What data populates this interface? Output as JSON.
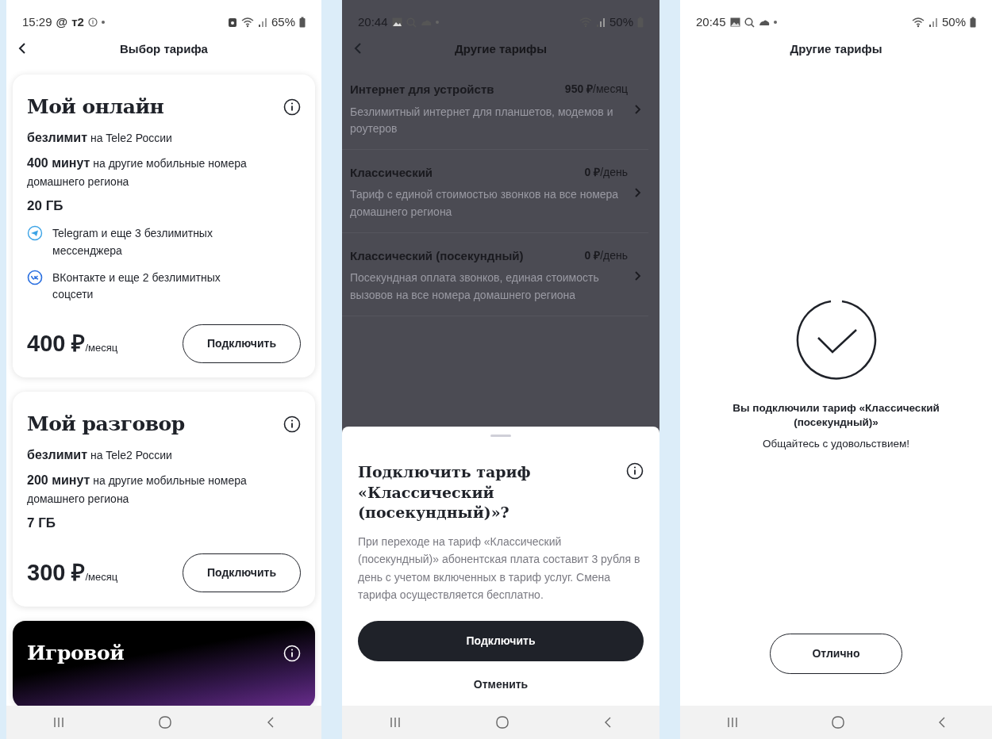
{
  "screens": [
    {
      "kind": "tariffs",
      "status_bar": {
        "time": "15:29",
        "glyphs": [
          "@",
          "т2"
        ],
        "battery": "65%"
      },
      "header": {
        "title": "Выбор тарифа",
        "back": true
      },
      "tariffs": [
        {
          "kind": "light",
          "name": "Мой онлайн",
          "features": [
            {
              "kind": "text",
              "text": "**безлимит** на Tele2 России"
            },
            {
              "kind": "text",
              "text": "**400 минут** на другие мобильные номера домашнего региона"
            },
            {
              "kind": "volume",
              "text": "20 ГБ"
            }
          ],
          "apps": [
            {
              "kind": "telegram",
              "text": "Telegram и еще 3 безлимитных мессенджера"
            },
            {
              "kind": "vk",
              "text": "ВКонтакте и еще 2 безлимитных соцсети"
            }
          ],
          "price": "400 ₽",
          "period": "/месяц",
          "button": "Подключить"
        },
        {
          "kind": "light",
          "name": "Мой разговор",
          "features": [
            {
              "kind": "text",
              "text": "**безлимит** на Tele2 России"
            },
            {
              "kind": "text",
              "text": "**200 минут** на другие мобильные номера домашнего региона"
            },
            {
              "kind": "volume",
              "text": "7 ГБ"
            }
          ],
          "price": "300 ₽",
          "period": "/месяц",
          "button": "Подключить"
        },
        {
          "kind": "dark",
          "name": "Игровой"
        }
      ]
    },
    {
      "kind": "confirm",
      "status_bar": {
        "time": "20:44",
        "battery": "50%"
      },
      "header": {
        "title": "Другие тарифы",
        "back": true
      },
      "list": [
        {
          "name": "Интернет для устройств",
          "price": "**950 ₽**/месяц",
          "description": "Безлимитный интернет для планшетов, модемов и роутеров"
        },
        {
          "name": "Классический",
          "price": "**0 ₽**/день",
          "description": "Тариф с единой стоимостью звонков на все номера домашнего региона"
        },
        {
          "name": "Классический (посекундный)",
          "price": "**0 ₽**/день",
          "description": "Посекундная оплата звонков, единая стоимость вызовов на все номера домашнего региона"
        }
      ],
      "sheet": {
        "title": "Подключить тариф «Классический (посекундный)»?",
        "text": "При переходе на тариф «Классический (посекундный)» абонентская плата составит 3 рубля в день с учетом включенных в тариф услуг. Смена тарифа осуществляется бесплатно.",
        "confirm": "Подключить",
        "cancel": "Отменить"
      }
    },
    {
      "kind": "success",
      "status_bar": {
        "time": "20:45",
        "battery": "50%"
      },
      "header": {
        "title": "Другие тарифы",
        "back": false
      },
      "message": "Вы подключили тариф «Классический (посекундный)»",
      "subtitle": "Общайтесь с удовольствием!",
      "button": "Отлично"
    }
  ]
}
